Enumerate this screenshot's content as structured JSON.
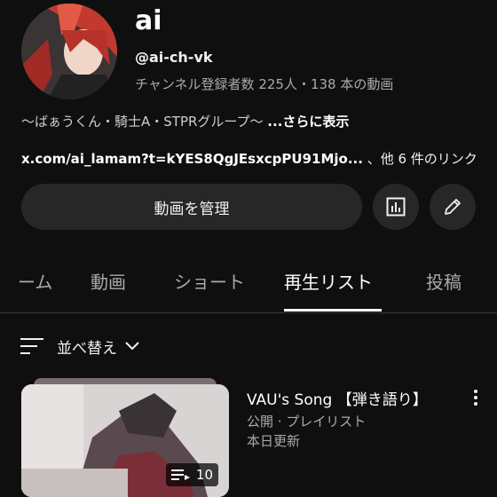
{
  "channel": {
    "name": "ai",
    "handle": "@ai-ch-vk",
    "stats": "チャンネル登録者数 225人・138 本の動画",
    "description": "〜ばぁうくん・騎士A・STPRグループ〜",
    "more_label": "...さらに表示",
    "link_url": "x.com/ai_lamam?t=kYES8QgJEsxcpPU91Mjo...",
    "link_others": "、他 6 件のリンク"
  },
  "actions": {
    "manage_label": "動画を管理",
    "analytics_icon": "analytics-icon",
    "edit_icon": "pencil-icon"
  },
  "tabs": [
    {
      "label": "ーム",
      "active": false
    },
    {
      "label": "動画",
      "active": false
    },
    {
      "label": "ショート",
      "active": false
    },
    {
      "label": "再生リスト",
      "active": true
    },
    {
      "label": "投稿",
      "active": false
    }
  ],
  "sort": {
    "label": "並べ替え"
  },
  "playlist": {
    "title": "VAU's Song 【弾き語り】",
    "visibility": "公開 · プレイリスト",
    "updated": "本日更新",
    "count": "10"
  },
  "colors": {
    "background": "#0f0f0f",
    "button": "#272727",
    "secondary_text": "#aaaaaa"
  }
}
